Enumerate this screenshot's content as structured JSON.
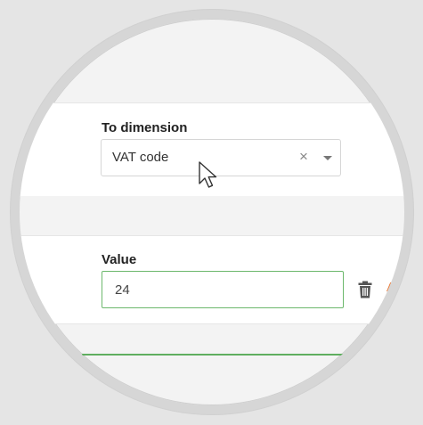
{
  "dimension_field": {
    "label": "To dimension",
    "selected_value": "VAT code",
    "clear_glyph": "×",
    "icons": [
      "clear-icon",
      "dropdown-arrow-icon"
    ]
  },
  "value_field": {
    "label": "Value",
    "value": "24"
  },
  "actions": {
    "delete_icon": "trash-icon",
    "add_label": "Ad"
  },
  "colors": {
    "accent_green": "#6cb86c",
    "link_orange": "#e8732e",
    "background": "#e5e5e5"
  }
}
